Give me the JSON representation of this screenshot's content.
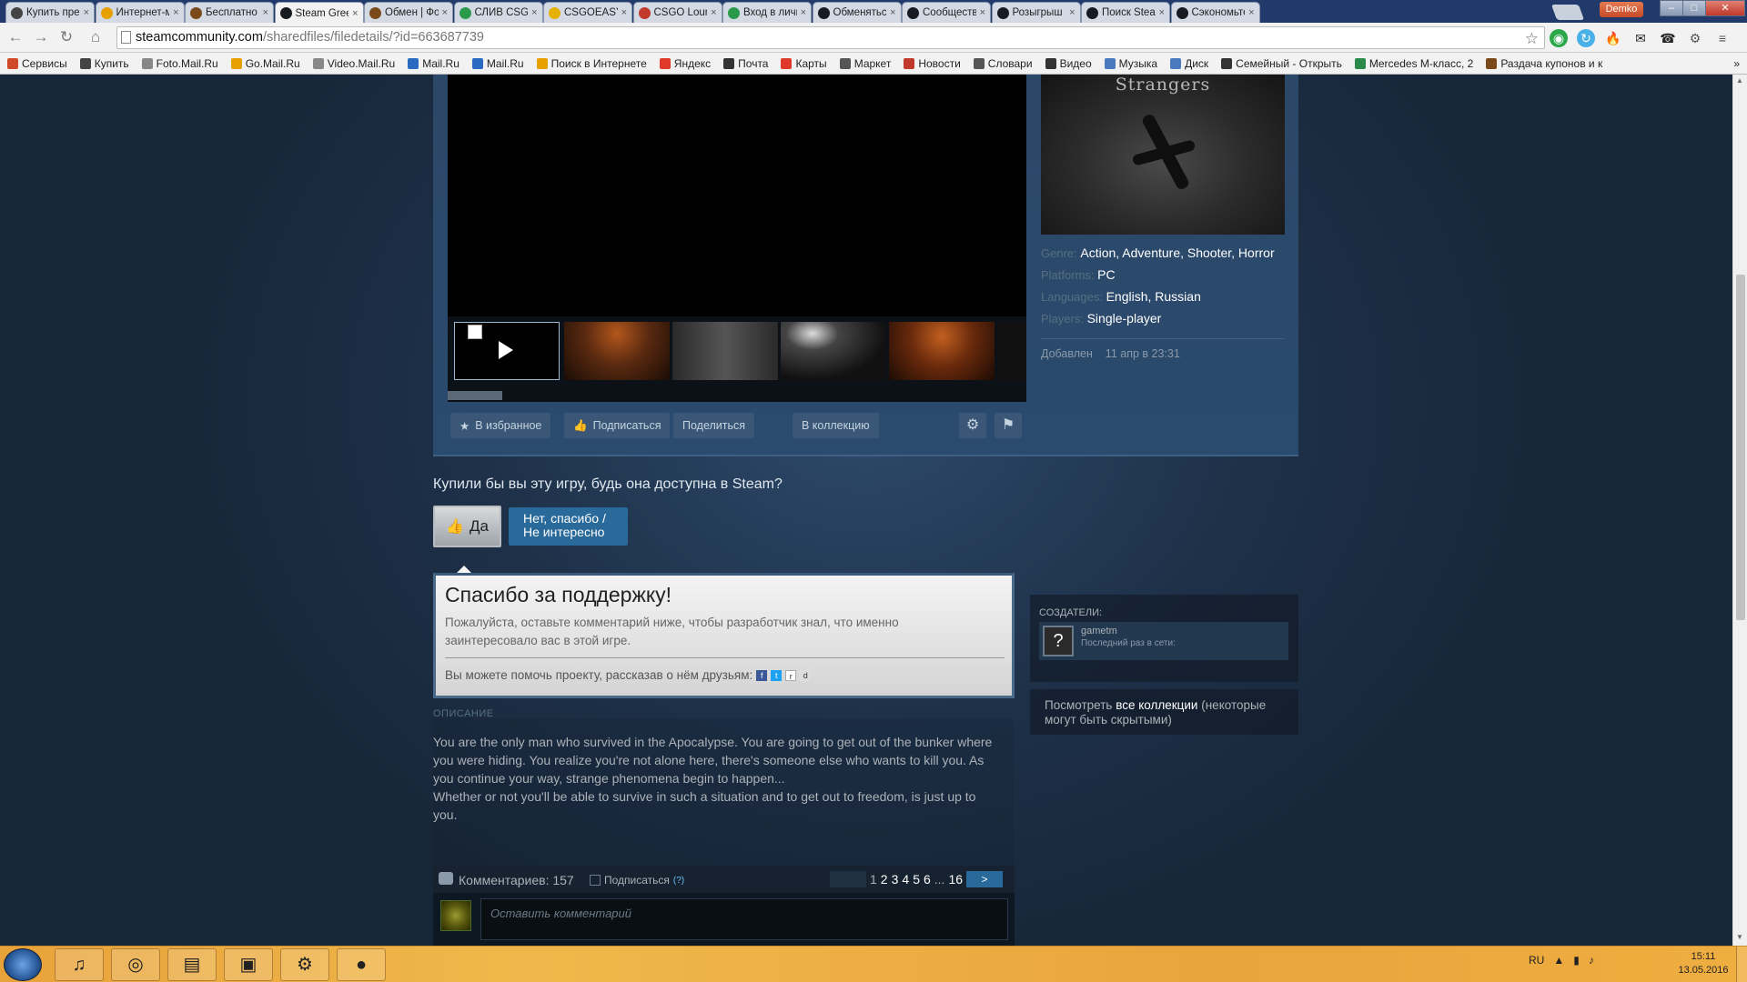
{
  "browser": {
    "tabs": [
      {
        "title": "Купить пре",
        "icon_color": "#444444",
        "active": false
      },
      {
        "title": "Интернет-м",
        "icon_color": "#e6a000",
        "active": false
      },
      {
        "title": "Бесплатно",
        "icon_color": "#7a4a1a",
        "active": false
      },
      {
        "title": "Steam Gree",
        "icon_color": "#171a21",
        "active": true
      },
      {
        "title": "Обмен | Фо",
        "icon_color": "#7a4a1a",
        "active": false
      },
      {
        "title": "СЛИВ CSGO",
        "icon_color": "#2a9a4a",
        "active": false
      },
      {
        "title": "CSGOEASYL",
        "icon_color": "#e6b000",
        "active": false
      },
      {
        "title": "CSGO Loun",
        "icon_color": "#c0392b",
        "active": false
      },
      {
        "title": "Вход в личн",
        "icon_color": "#2a9a4a",
        "active": false
      },
      {
        "title": "Обменятьс",
        "icon_color": "#171a21",
        "active": false
      },
      {
        "title": "Сообществ",
        "icon_color": "#171a21",
        "active": false
      },
      {
        "title": "Розыгрыш",
        "icon_color": "#171a21",
        "active": false
      },
      {
        "title": "Поиск Stea",
        "icon_color": "#171a21",
        "active": false
      },
      {
        "title": "Сэкономьте",
        "icon_color": "#171a21",
        "active": false
      }
    ],
    "close_glyph": "×",
    "user_button": "Demko",
    "url_host": "steamcommunity.com",
    "url_path": "/sharedfiles/filedetails/?id=663687739",
    "bookmarks": [
      {
        "label": "Сервисы",
        "color": "#d04a2a"
      },
      {
        "label": "Купить",
        "color": "#444444"
      },
      {
        "label": "Foto.Mail.Ru",
        "color": "#888888"
      },
      {
        "label": "Go.Mail.Ru",
        "color": "#e6a000"
      },
      {
        "label": "Video.Mail.Ru",
        "color": "#888888"
      },
      {
        "label": "Mail.Ru",
        "color": "#2a6ac0"
      },
      {
        "label": "Mail.Ru",
        "color": "#2a6ac0"
      },
      {
        "label": "Поиск в Интернете",
        "color": "#e6a000"
      },
      {
        "label": "Яндекс",
        "color": "#e03a2a"
      },
      {
        "label": "Почта",
        "color": "#333333"
      },
      {
        "label": "Карты",
        "color": "#e03a2a"
      },
      {
        "label": "Маркет",
        "color": "#555555"
      },
      {
        "label": "Новости",
        "color": "#c0392b"
      },
      {
        "label": "Словари",
        "color": "#555555"
      },
      {
        "label": "Видео",
        "color": "#333333"
      },
      {
        "label": "Музыка",
        "color": "#4a7ac0"
      },
      {
        "label": "Диск",
        "color": "#4a7ac0"
      },
      {
        "label": "Семейный - Открыть",
        "color": "#333333"
      },
      {
        "label": "Mercedes М-класс, 2",
        "color": "#2a8a4a"
      },
      {
        "label": "Раздача купонов и к",
        "color": "#7a4a1a"
      }
    ]
  },
  "game": {
    "cover_title": "Strangers",
    "genre_label": "Genre:",
    "genres": "Action, Adventure, Shooter, Horror",
    "platforms_label": "Platforms:",
    "platforms": "PC",
    "languages_label": "Languages:",
    "languages": "English, Russian",
    "players_label": "Players:",
    "players": "Single-player",
    "added_label": "Добавлен",
    "added_value": "11 апр в 23:31"
  },
  "actions": {
    "favorite": "В избранное",
    "subscribe": "Подписаться",
    "share": "Поделиться",
    "collection": "В коллекцию"
  },
  "vote": {
    "question": "Купили бы вы эту игру, будь она доступна в Steam?",
    "yes": "Да",
    "no_line1": "Нет, спасибо /",
    "no_line2": "Не интересно"
  },
  "thanks": {
    "title": "Спасибо за поддержку!",
    "text": "Пожалуйста, оставьте комментарий ниже, чтобы разработчик знал, что именно заинтересовало вас в этой игре.",
    "share_text": "Вы можете помочь проекту, рассказав о нём друзьям:"
  },
  "description": {
    "label": "ОПИСАНИЕ",
    "para1": "You are the only man who survived in the Apocalypse. You are going to get out of the bunker where you were hiding. You realize you're not alone here, there's someone else who wants to kill you. As you continue your way, strange phenomena begin to happen...",
    "para2": "Whether or not you'll be able to survive in such a situation and to get out to freedom, is just up to you."
  },
  "comments": {
    "label": "Комментариев: 157",
    "subscribe": "Подписаться",
    "help": "(?)",
    "pages": [
      "1",
      "2",
      "3",
      "4",
      "5",
      "6"
    ],
    "ellipsis": "...",
    "last_page": "16",
    "next": ">",
    "placeholder": "Оставить комментарий"
  },
  "creators": {
    "label": "СОЗДАТЕЛИ:",
    "name": "gametm",
    "last_online": "Последний раз в сети:",
    "avatar_glyph": "?"
  },
  "collections": {
    "prefix": "Посмотреть",
    "link": "все коллекции",
    "suffix": "(некоторые могут быть скрытыми)"
  },
  "taskbar": {
    "lang": "RU",
    "time": "15:11",
    "date": "13.05.2016"
  }
}
